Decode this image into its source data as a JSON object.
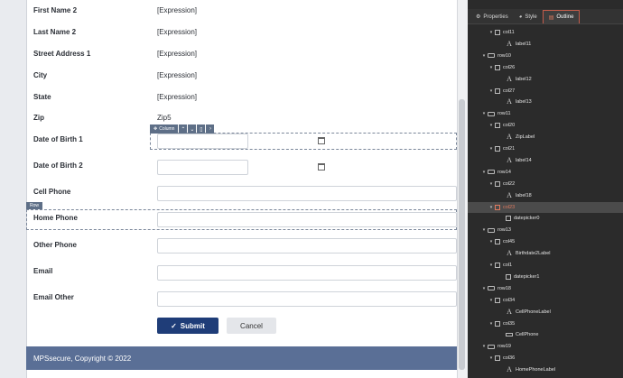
{
  "form": {
    "fields": [
      {
        "label": "First Name 2",
        "value": "[Expression]"
      },
      {
        "label": "Last Name 2",
        "value": "[Expression]"
      },
      {
        "label": "Street Address 1",
        "value": "[Expression]"
      },
      {
        "label": "City",
        "value": "[Expression]"
      },
      {
        "label": "State",
        "value": "[Expression]"
      },
      {
        "label": "Zip",
        "value": "Zip5"
      },
      {
        "label": "Date of Birth 1"
      },
      {
        "label": "Date of Birth 2"
      },
      {
        "label": "Cell Phone"
      },
      {
        "label": "Home Phone"
      },
      {
        "label": "Other Phone"
      },
      {
        "label": "Email"
      },
      {
        "label": "Email Other"
      }
    ],
    "column_tag": "Column",
    "row_tag": "Row",
    "submit_label": "Submit",
    "cancel_label": "Cancel",
    "footer_text": "MPSsecure, Copyright © 2022"
  },
  "panel": {
    "tabs": [
      {
        "label": "Properties",
        "icon": "gear-icon"
      },
      {
        "label": "Style",
        "icon": "palette-icon"
      },
      {
        "label": "Outline",
        "icon": "outline-icon",
        "active": true
      }
    ],
    "tree": [
      {
        "text": "col11",
        "type": "col",
        "level": 2,
        "expanded": true
      },
      {
        "text": "label11",
        "type": "label",
        "level": 3
      },
      {
        "text": "row10",
        "type": "row",
        "level": 1,
        "expanded": true
      },
      {
        "text": "col26",
        "type": "col",
        "level": 2,
        "expanded": true
      },
      {
        "text": "label12",
        "type": "label",
        "level": 3
      },
      {
        "text": "col27",
        "type": "col",
        "level": 2,
        "expanded": true
      },
      {
        "text": "label13",
        "type": "label",
        "level": 3
      },
      {
        "text": "row11",
        "type": "row",
        "level": 1,
        "expanded": true
      },
      {
        "text": "col20",
        "type": "col",
        "level": 2,
        "expanded": true
      },
      {
        "text": "ZipLabel",
        "type": "label",
        "level": 3
      },
      {
        "text": "col21",
        "type": "col",
        "level": 2,
        "expanded": true
      },
      {
        "text": "label14",
        "type": "label",
        "level": 3
      },
      {
        "text": "row14",
        "type": "row",
        "level": 1,
        "expanded": true
      },
      {
        "text": "col22",
        "type": "col",
        "level": 2,
        "expanded": true
      },
      {
        "text": "label18",
        "type": "label",
        "level": 3
      },
      {
        "text": "col23",
        "type": "col",
        "level": 2,
        "expanded": true,
        "selected": true
      },
      {
        "text": "datepicker0",
        "type": "date",
        "level": 3
      },
      {
        "text": "row13",
        "type": "row",
        "level": 1,
        "expanded": true
      },
      {
        "text": "col45",
        "type": "col",
        "level": 2,
        "expanded": true
      },
      {
        "text": "Birthdate2Label",
        "type": "label",
        "level": 3
      },
      {
        "text": "col1",
        "type": "col",
        "level": 2,
        "expanded": true
      },
      {
        "text": "datepicker1",
        "type": "date",
        "level": 3
      },
      {
        "text": "row18",
        "type": "row",
        "level": 1,
        "expanded": true
      },
      {
        "text": "col34",
        "type": "col",
        "level": 2,
        "expanded": true
      },
      {
        "text": "CellPhoneLabel",
        "type": "label",
        "level": 3
      },
      {
        "text": "col35",
        "type": "col",
        "level": 2,
        "expanded": true
      },
      {
        "text": "CellPhone",
        "type": "input",
        "level": 3
      },
      {
        "text": "row19",
        "type": "row",
        "level": 1,
        "expanded": true
      },
      {
        "text": "col36",
        "type": "col",
        "level": 2,
        "expanded": true
      },
      {
        "text": "HomePhoneLabel",
        "type": "label",
        "level": 3
      }
    ]
  }
}
